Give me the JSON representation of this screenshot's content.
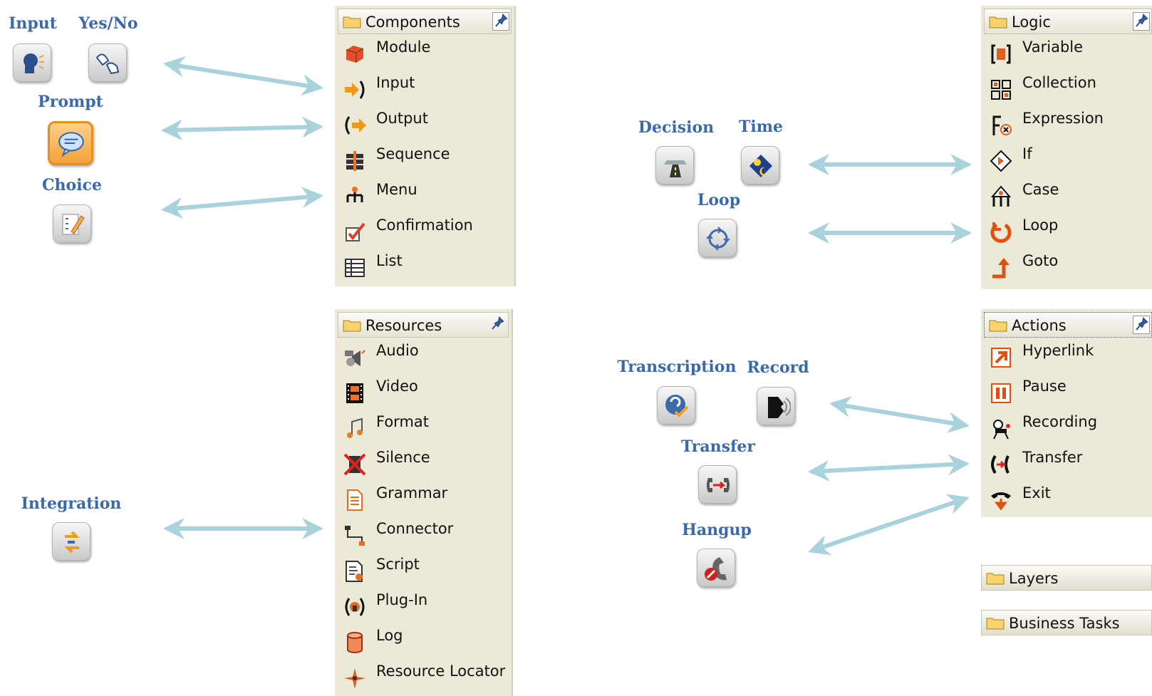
{
  "components": {
    "title": "Components",
    "items": [
      "Module",
      "Input",
      "Output",
      "Sequence",
      "Menu",
      "Confirmation",
      "List"
    ]
  },
  "logic": {
    "title": "Logic",
    "items": [
      "Variable",
      "Collection",
      "Expression",
      "If",
      "Case",
      "Loop",
      "Goto"
    ]
  },
  "resources": {
    "title": "Resources",
    "items": [
      "Audio",
      "Video",
      "Format",
      "Silence",
      "Grammar",
      "Connector",
      "Script",
      "Plug-In",
      "Log",
      "Resource Locator"
    ]
  },
  "actions": {
    "title": "Actions",
    "items": [
      "Hyperlink",
      "Pause",
      "Recording",
      "Transfer",
      "Exit"
    ]
  },
  "layers": {
    "title": "Layers"
  },
  "business_tasks": {
    "title": "Business Tasks"
  },
  "nodes": {
    "input": "Input",
    "yesno": "Yes/No",
    "prompt": "Prompt",
    "choice": "Choice",
    "integration": "Integration",
    "decision": "Decision",
    "time": "Time",
    "loop": "Loop",
    "transcription": "Transcription",
    "record": "Record",
    "transfer": "Transfer",
    "hangup": "Hangup"
  },
  "colors": {
    "label": "#3b6aa8",
    "arrow": "#a9d3dc",
    "panel": "#ece9d8",
    "selected": "#f08a1a"
  }
}
